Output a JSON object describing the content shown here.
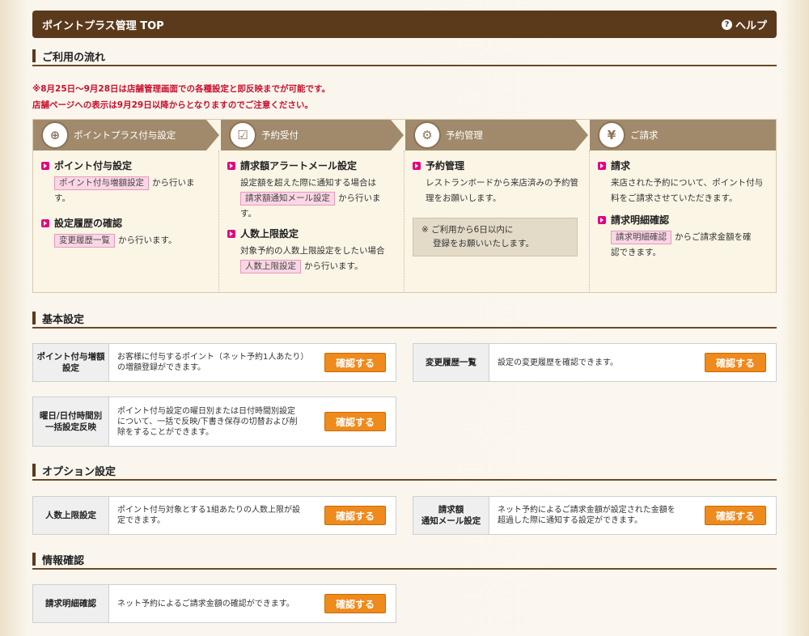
{
  "header": {
    "title": "ポイントプラス管理 TOP",
    "help": "ヘルプ"
  },
  "flow_section": {
    "title": "ご利用の流れ"
  },
  "notice": {
    "line1": "※8月25日～9月28日は店舗管理画面での各種設定と即反映までが可能です。",
    "line2": "店舗ページへの表示は9月29日以降からとなりますのでご注意ください。"
  },
  "steps": [
    {
      "title": "ポイントプラス付与設定",
      "icon": "coin-plus-icon"
    },
    {
      "title": "予約受付",
      "icon": "calendar-check-icon"
    },
    {
      "title": "予約管理",
      "icon": "calendar-gear-icon"
    },
    {
      "title": "ご請求",
      "icon": "yen-icon"
    }
  ],
  "col1": {
    "h1": "ポイント付与設定",
    "link1": "ポイント付与増額設定",
    "t1": "から行いま",
    "t1b": "す。",
    "h2": "設定履歴の確認",
    "link2": "変更履歴一覧",
    "t2": "から行います。"
  },
  "col2": {
    "h1": "請求額アラートメール設定",
    "t1a": "設定額を超えた際に通知する場合は",
    "link1": "請求額通知メール設定",
    "t1": "から行いま",
    "t1b": "す。",
    "h2": "人数上限設定",
    "t2a": "対象予約の人数上限設定をしたい場合",
    "link2": "人数上限設定",
    "t2": "から行います。"
  },
  "col3": {
    "h1": "予約管理",
    "t1a": "レストランボードから来店済みの予約管",
    "t1b": "理をお願いします。",
    "note1": "※  ご利用から6日以内に",
    "note2": "登録をお願いいたします。"
  },
  "col4": {
    "h1": "請求",
    "t1a": "来店された予約について、ポイント付与",
    "t1b": "料をご請求させていただきます。",
    "h2": "請求明細確認",
    "link2": "請求明細確認",
    "t2": "からご請求金額を確",
    "t2b": "認できます。"
  },
  "basic": {
    "title": "基本設定"
  },
  "option": {
    "title": "オプション設定"
  },
  "info": {
    "title": "情報確認"
  },
  "button_label": "確認する",
  "rows": {
    "r1": {
      "label1": "ポイント付与増額",
      "label2": "設定",
      "text1": "お客様に付与するポイント（ネット予約1人あたり）",
      "text2": "の増額登録ができます。"
    },
    "r2": {
      "label": "変更履歴一覧",
      "text": "設定の変更履歴を確認できます。"
    },
    "r3": {
      "label1": "曜日/日付時間別",
      "label2": "一括設定反映",
      "text1": "ポイント付与設定の曜日別または日付時間別設定",
      "text2": "について、一括で反映/下書き保存の切替および削",
      "text3": "除をすることができます。"
    },
    "r4": {
      "label": "人数上限設定",
      "text1": "ポイント付与対象とする1組あたりの人数上限が設",
      "text2": "定できます。"
    },
    "r5": {
      "label1": "請求額",
      "label2": "通知メール設定",
      "text1": "ネット予約によるご請求金額が設定された金額を",
      "text2": "超過した際に通知する設定ができます。"
    },
    "r6": {
      "label": "請求明細確認",
      "text": "ネット予約によるご請求金額の確認ができます。"
    }
  }
}
